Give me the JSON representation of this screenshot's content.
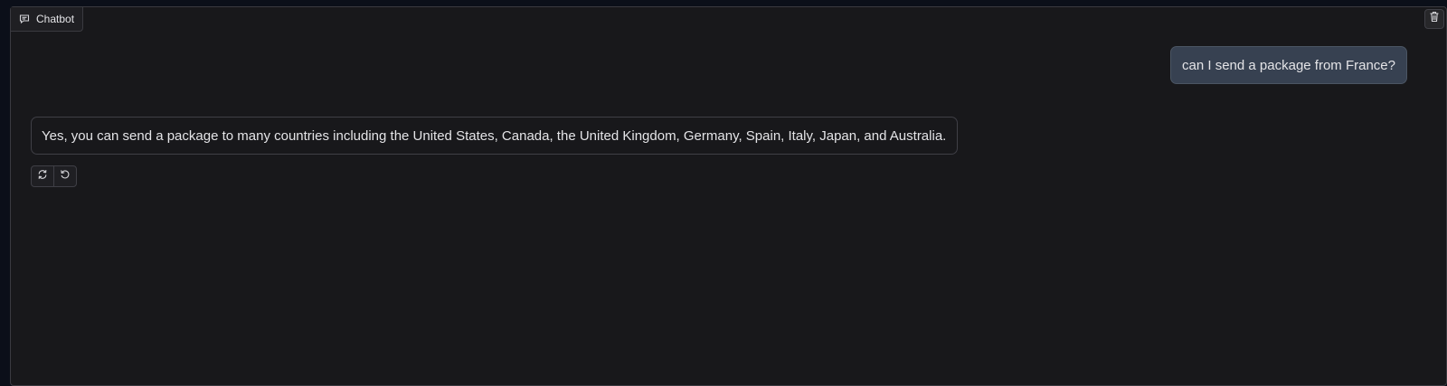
{
  "chatbot": {
    "label": "Chatbot",
    "label_icon": "chat-bubble-icon",
    "clear_icon": "trash-icon"
  },
  "messages": [
    {
      "role": "user",
      "text": "can I send a package from France?"
    },
    {
      "role": "bot",
      "text": "Yes, you can send a package to many countries including the United States, Canada, the United Kingdom, Germany, Spain, Italy, Japan, and Australia."
    }
  ],
  "bot_actions": [
    {
      "icon": "retry-icon"
    },
    {
      "icon": "undo-icon"
    }
  ],
  "colors": {
    "background": "#18181b",
    "user_bubble": "#374151",
    "text": "#e4e4e7",
    "border": "#3f3f46"
  }
}
